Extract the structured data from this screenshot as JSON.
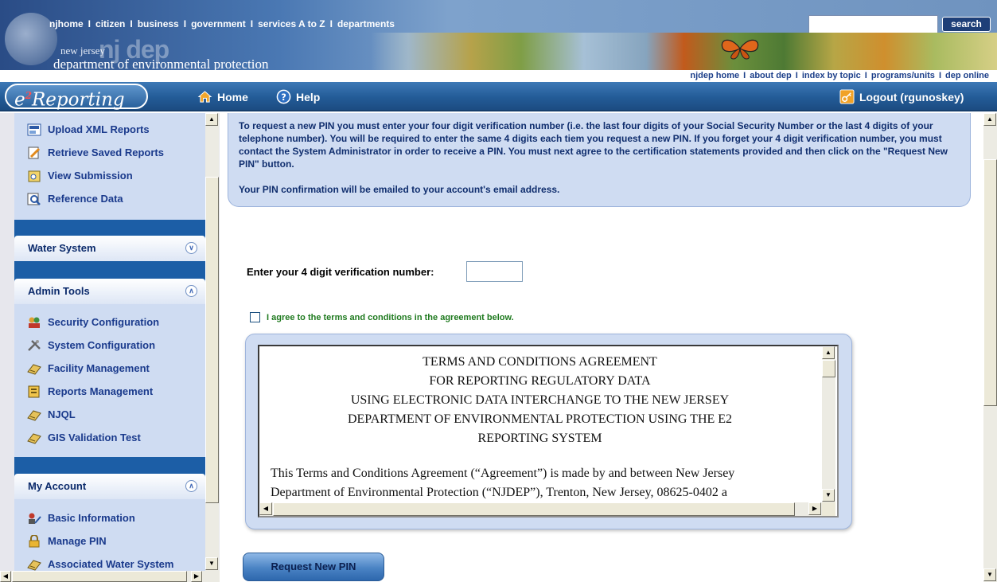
{
  "header": {
    "top_nav": [
      "njhome",
      "citizen",
      "business",
      "government",
      "services A to Z",
      "departments"
    ],
    "separator": "I",
    "search_button": "search",
    "search_value": "",
    "logo_newjersey": "new jersey",
    "logo_njdep": "nj dep",
    "logo_department": "department of environmental protection",
    "sub_nav": [
      "njdep home",
      "about dep",
      "index by topic",
      "programs/units",
      "dep online"
    ]
  },
  "appbar": {
    "logo_text": "Reporting",
    "logo_sup": "2",
    "logo_prefix": "e",
    "home_label": "Home",
    "help_label": "Help",
    "logout_label": "Logout (rgunoskey)"
  },
  "sidebar": {
    "top_items": [
      {
        "label": "Upload XML Reports",
        "icon": "upload-xml-icon"
      },
      {
        "label": "Retrieve Saved Reports",
        "icon": "retrieve-reports-icon"
      },
      {
        "label": "View Submission",
        "icon": "view-submission-icon"
      },
      {
        "label": "Reference Data",
        "icon": "reference-data-icon"
      }
    ],
    "water_system": {
      "title": "Water System",
      "state": "collapsed"
    },
    "admin_tools": {
      "title": "Admin Tools",
      "state": "expanded",
      "items": [
        {
          "label": "Security Configuration",
          "icon": "security-config-icon"
        },
        {
          "label": "System Configuration",
          "icon": "system-config-icon"
        },
        {
          "label": "Facility Management",
          "icon": "facility-management-icon"
        },
        {
          "label": "Reports Management",
          "icon": "reports-management-icon"
        },
        {
          "label": "NJQL",
          "icon": "njql-icon"
        },
        {
          "label": "GIS Validation Test",
          "icon": "gis-validation-icon"
        }
      ]
    },
    "my_account": {
      "title": "My Account",
      "state": "expanded",
      "items": [
        {
          "label": "Basic Information",
          "icon": "basic-info-icon"
        },
        {
          "label": "Manage PIN",
          "icon": "lock-icon"
        },
        {
          "label": "Associated Water System",
          "icon": "associated-water-system-icon"
        }
      ]
    }
  },
  "main": {
    "info_paragraph_1": "To request a new PIN you must enter your four digit verification number (i.e. the last four digits of your Social Security Number or the last 4 digits of your telephone number). You will be required to enter the same 4 digits each tiem you request a new PIN. If you forget your 4 digit verification number, you must contact the System Administrator in order to receive a PIN. You must next agree to the certification statements provided and then click on the \"Request New PIN\" button.",
    "info_paragraph_2": "Your PIN confirmation will be emailed to your account's email address.",
    "pin_label": "Enter your 4 digit verification number:",
    "pin_value": "",
    "agree_label": "I agree to the terms and conditions in the agreement below.",
    "agree_checked": false,
    "terms_title_lines": [
      "TERMS AND CONDITIONS AGREEMENT",
      "FOR REPORTING REGULATORY DATA",
      "USING ELECTRONIC DATA INTERCHANGE TO THE NEW JERSEY",
      "DEPARTMENT OF ENVIRONMENTAL PROTECTION USING THE E2",
      "REPORTING SYSTEM"
    ],
    "terms_body_lines": [
      "This Terms and Conditions Agreement (“Agreement”) is made by and between New Jersey",
      "Department of Environmental Protection (“NJDEP”), Trenton, New Jersey, 08625-0402 a"
    ],
    "request_button": "Request New PIN"
  },
  "colors": {
    "banner_blue": "#2a4c86",
    "appbar_blue": "#235b97",
    "sidebar_blue": "#1c5ea6",
    "panel_light": "#cfdcf2",
    "link_blue": "#1a3a8c",
    "agree_green": "#1f7a1f"
  }
}
